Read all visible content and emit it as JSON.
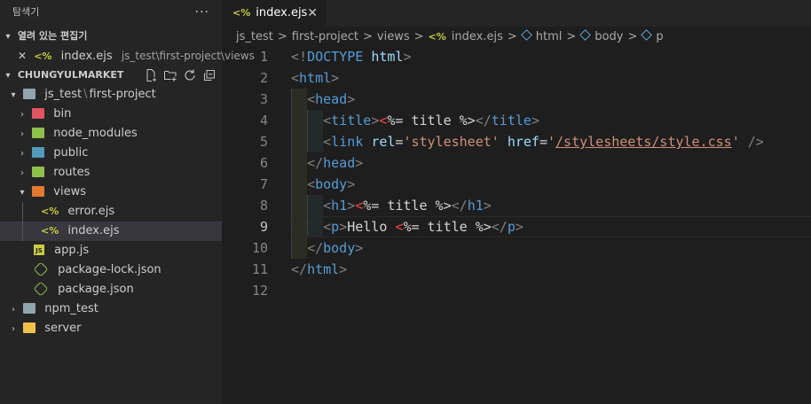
{
  "explorer": {
    "title": "탐색기",
    "more": "···",
    "open_editors": {
      "label": "열려 있는 편집기",
      "items": [
        {
          "name": "index.ejs",
          "path": "js_test\\first-project\\views",
          "icon": "ejs-icon"
        }
      ]
    },
    "workspace": {
      "label": "CHUNGYULMARKET",
      "actions": [
        "new-file-icon",
        "new-folder-icon",
        "refresh-icon",
        "collapse-all-icon"
      ]
    },
    "tree": [
      {
        "label": "js_test",
        "label2": "first-project",
        "type": "folder-open",
        "indent": 0
      },
      {
        "label": "bin",
        "type": "folder",
        "indent": 1,
        "color": "#e05561"
      },
      {
        "label": "node_modules",
        "type": "folder",
        "indent": 1,
        "color": "#8dc149"
      },
      {
        "label": "public",
        "type": "folder",
        "indent": 1,
        "color": "#519aba"
      },
      {
        "label": "routes",
        "type": "folder",
        "indent": 1,
        "color": "#8dc149"
      },
      {
        "label": "views",
        "type": "folder-open",
        "indent": 1,
        "color": "#e37933"
      },
      {
        "label": "error.ejs",
        "type": "ejs",
        "indent": 2
      },
      {
        "label": "index.ejs",
        "type": "ejs",
        "indent": 2,
        "selected": true
      },
      {
        "label": "app.js",
        "type": "js",
        "indent": 1
      },
      {
        "label": "package-lock.json",
        "type": "json",
        "indent": 1
      },
      {
        "label": "package.json",
        "type": "json",
        "indent": 1
      },
      {
        "label": "npm_test",
        "type": "folder",
        "indent": 0,
        "color": "#90a4ae"
      },
      {
        "label": "server",
        "type": "folder",
        "indent": 0,
        "color": "#f0c14b"
      }
    ]
  },
  "tab": {
    "label": "index.ejs",
    "icon": "<%",
    "close": "✕"
  },
  "breadcrumb": {
    "items": [
      "js_test",
      "first-project",
      "views",
      "index.ejs",
      "html",
      "body",
      "p"
    ],
    "separator": ">"
  },
  "editor": {
    "active_line": 9,
    "lines": [
      {
        "n": "1",
        "code": "<!DOCTYPE html>"
      },
      {
        "n": "2",
        "code": "<html>"
      },
      {
        "n": "3",
        "code": "  <head>"
      },
      {
        "n": "4",
        "code": "    <title><%= title %></title>"
      },
      {
        "n": "5",
        "code": "    <link rel='stylesheet' href='/stylesheets/style.css' />"
      },
      {
        "n": "6",
        "code": "  </head>"
      },
      {
        "n": "7",
        "code": "  <body>"
      },
      {
        "n": "8",
        "code": "    <h1><%= title %></h1>"
      },
      {
        "n": "9",
        "code": "    <p>Hello <%= title %></p>"
      },
      {
        "n": "10",
        "code": "  </body>"
      },
      {
        "n": "11",
        "code": "</html>"
      },
      {
        "n": "12",
        "code": ""
      }
    ]
  },
  "colors": {
    "editor_bg": "#1e1e1e",
    "sidebar_bg": "#252526",
    "tag": "#569cd6",
    "attribute": "#9cdcfe",
    "string": "#ce9178",
    "ejs_delimiter": "#f44747",
    "ejs_icon": "#cbcb41"
  }
}
